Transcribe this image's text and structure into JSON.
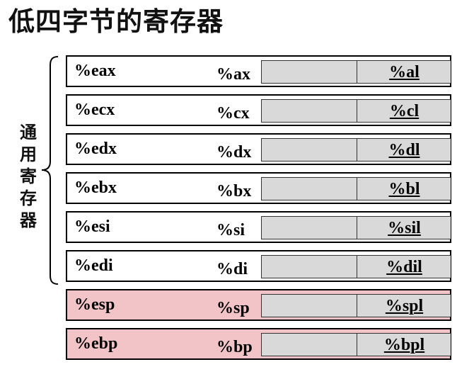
{
  "title": "低四字节的寄存器",
  "side_label": "通\n用\n寄\n存\n器",
  "registers": [
    {
      "r32": "%eax",
      "r16": "%ax",
      "r8": "%al",
      "special": false
    },
    {
      "r32": "%ecx",
      "r16": "%cx",
      "r8": "%cl",
      "special": false
    },
    {
      "r32": "%edx",
      "r16": "%dx",
      "r8": "%dl",
      "special": false
    },
    {
      "r32": "%ebx",
      "r16": "%bx",
      "r8": "%bl",
      "special": false
    },
    {
      "r32": "%esi",
      "r16": "%si",
      "r8": "%sil",
      "special": false
    },
    {
      "r32": "%edi",
      "r16": "%di",
      "r8": "%dil",
      "special": false
    },
    {
      "r32": "%esp",
      "r16": "%sp",
      "r8": "%spl",
      "special": true
    },
    {
      "r32": "%ebp",
      "r16": "%bp",
      "r8": "%bpl",
      "special": true
    }
  ],
  "colors": {
    "special_row_bg": "#f2c4c7",
    "byte_box_bg": "#d9d9d9"
  }
}
